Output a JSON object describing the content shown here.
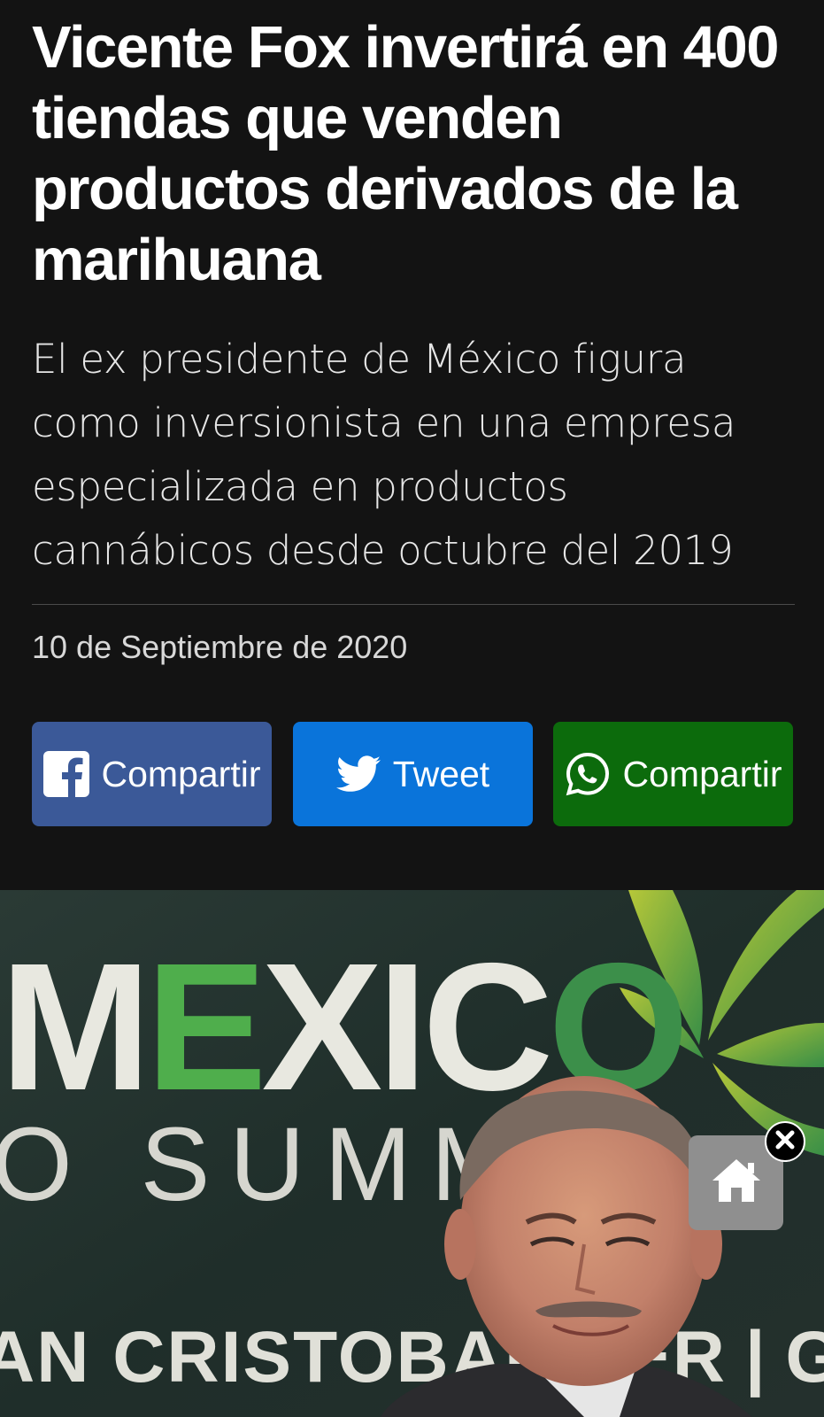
{
  "article": {
    "headline": "Vicente Fox invertirá en 400 tiendas que venden productos derivados de la marihuana",
    "subheadline": "El ex presidente de México figura como inversionista en una empresa especializada en productos cannábicos desde octubre del 2019",
    "date": "10 de Septiembre de 2020"
  },
  "share": {
    "facebook": {
      "label": "Compartir",
      "icon": "facebook-icon",
      "color": "#3b5998"
    },
    "twitter": {
      "label": "Tweet",
      "icon": "twitter-icon",
      "color": "#0a74da"
    },
    "whatsapp": {
      "label": "Compartir",
      "icon": "whatsapp-icon",
      "color": "#0c6b0c"
    }
  },
  "photo": {
    "banner_line1": "MEXICO",
    "banner_line2": "SUMMIT",
    "banner_line3": "AN CRISTOBAL",
    "banner_line3_suffix": "ER | G"
  },
  "floating": {
    "home_icon": "home-icon",
    "close_icon": "close-icon"
  },
  "colors": {
    "background": "#131313",
    "facebook": "#3b5998",
    "twitter": "#0a74da",
    "whatsapp": "#0c6b0c",
    "home_button": "#8f8f8f"
  }
}
